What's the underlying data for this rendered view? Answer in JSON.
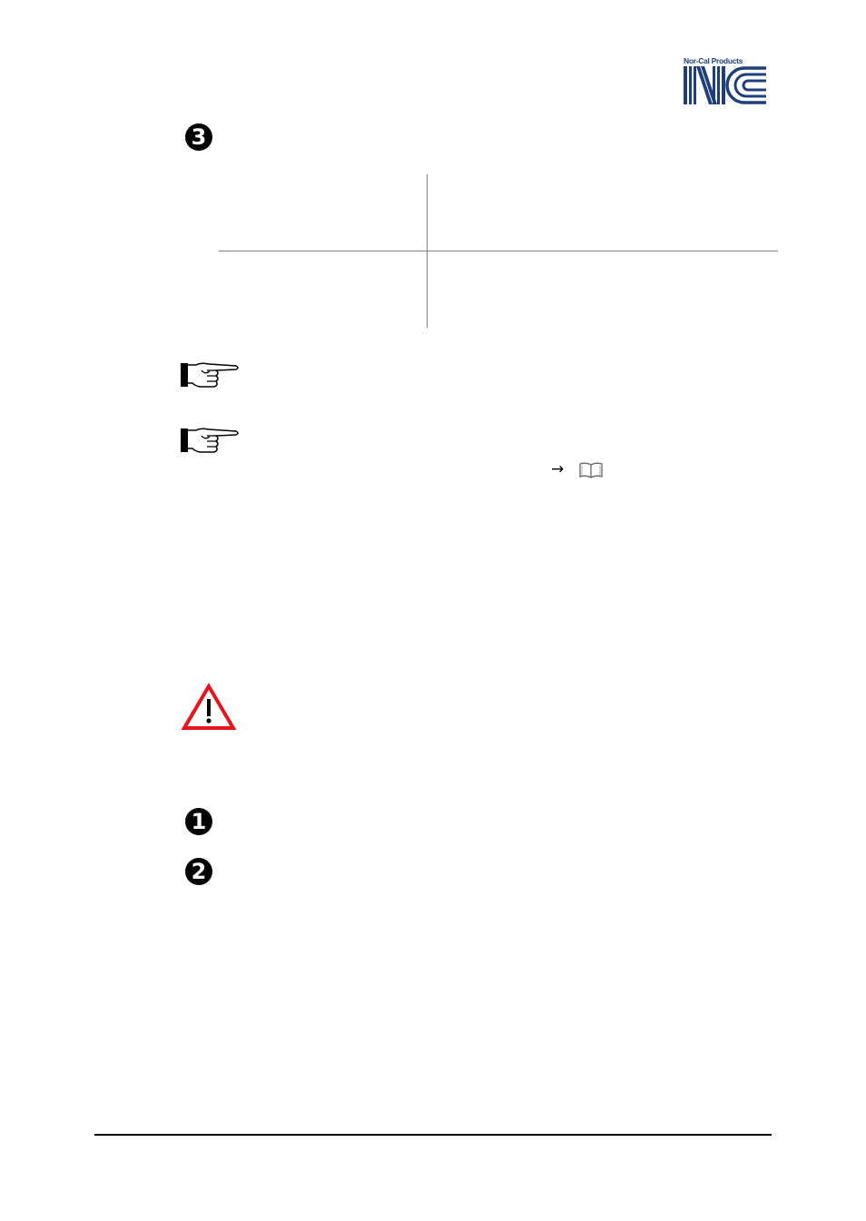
{
  "header": {
    "logo": {
      "company_name": "Nor-Cal Products",
      "monogram": "NC",
      "brand_color": "#1f3f7a"
    }
  },
  "steps": {
    "step3": {
      "number": "3",
      "icon": "numbered-circle-icon"
    },
    "step1": {
      "number": "1",
      "icon": "numbered-circle-icon"
    },
    "step2": {
      "number": "2",
      "icon": "numbered-circle-icon"
    }
  },
  "table": {
    "rows": [
      [
        "",
        ""
      ],
      [
        "",
        ""
      ]
    ]
  },
  "notes": [
    {
      "icon": "pointing-hand-icon",
      "text": ""
    },
    {
      "icon": "pointing-hand-icon",
      "text": "",
      "reference_arrow": "→",
      "reference_icon": "book-icon"
    }
  ],
  "warning": {
    "icon": "warning-triangle-icon",
    "color": "#e8141c",
    "text": ""
  },
  "footer": {
    "rule": "footer-divider"
  }
}
